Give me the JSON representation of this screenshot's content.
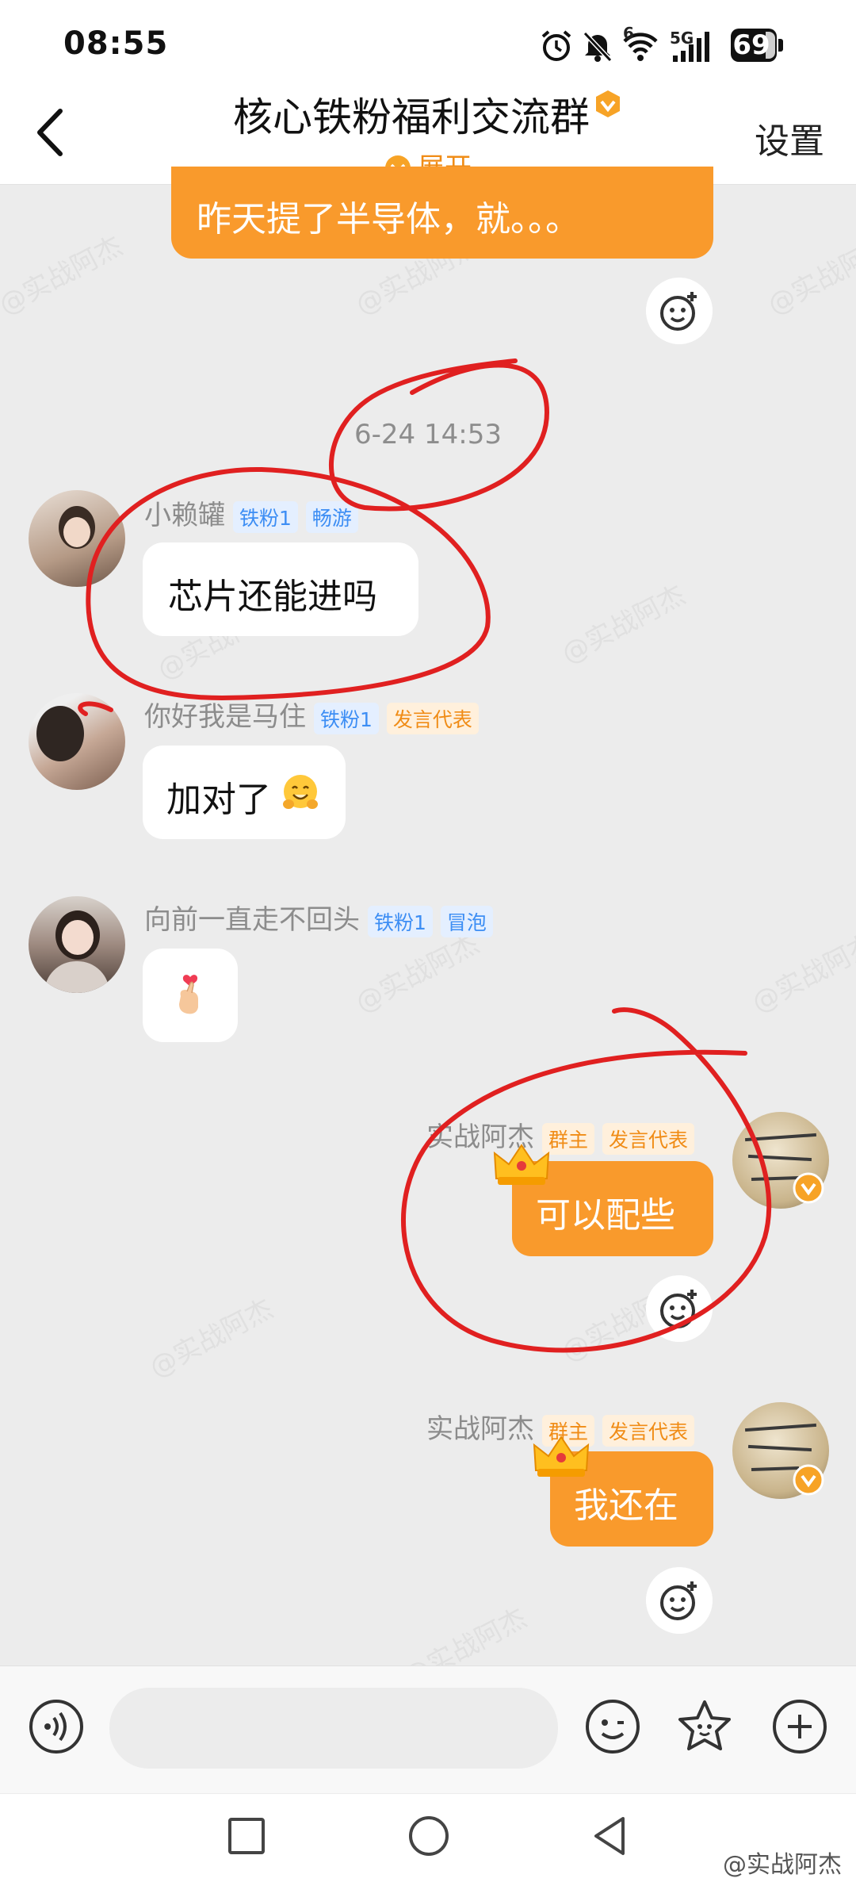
{
  "status_bar": {
    "time": "08:55",
    "battery": "69",
    "network": "5G",
    "signal_sup": "6"
  },
  "header": {
    "title": "核心铁粉福利交流群",
    "expand_label": "展开",
    "settings_label": "设置"
  },
  "chat": {
    "prev_message": "昨天提了半导体，就。。。",
    "timestamp": "6-24 14:53",
    "messages": [
      {
        "sender": "小赖罐",
        "tags": [
          "铁粉1",
          "畅游"
        ],
        "text": "芯片还能进吗"
      },
      {
        "sender": "你好我是马住",
        "tags": [
          "铁粉1",
          "发言代表"
        ],
        "text": "加对了"
      },
      {
        "sender": "向前一直走不回头",
        "tags": [
          "铁粉1",
          "冒泡"
        ],
        "text": ""
      },
      {
        "sender": "实战阿杰",
        "tags": [
          "群主",
          "发言代表"
        ],
        "text": "可以配些"
      },
      {
        "sender": "实战阿杰",
        "tags": [
          "群主",
          "发言代表"
        ],
        "text": "我还在"
      }
    ],
    "watermark": "@实战阿杰"
  },
  "input_bar": {
    "placeholder": ""
  },
  "footer_watermark": "@实战阿杰",
  "colors": {
    "accent": "#f99a2c",
    "annotation": "#e02020",
    "tag_blue": "#3d8ef4"
  },
  "icons": [
    "alarm-icon",
    "mute-icon",
    "wifi-icon",
    "signal-icon",
    "battery-icon",
    "back-icon",
    "verified-badge-icon",
    "expand-chevron-icon",
    "add-reaction-icon",
    "crown-icon",
    "voice-icon",
    "emoji-icon",
    "sticker-icon",
    "plus-icon",
    "nav-recent-icon",
    "nav-home-icon",
    "nav-back-icon"
  ]
}
